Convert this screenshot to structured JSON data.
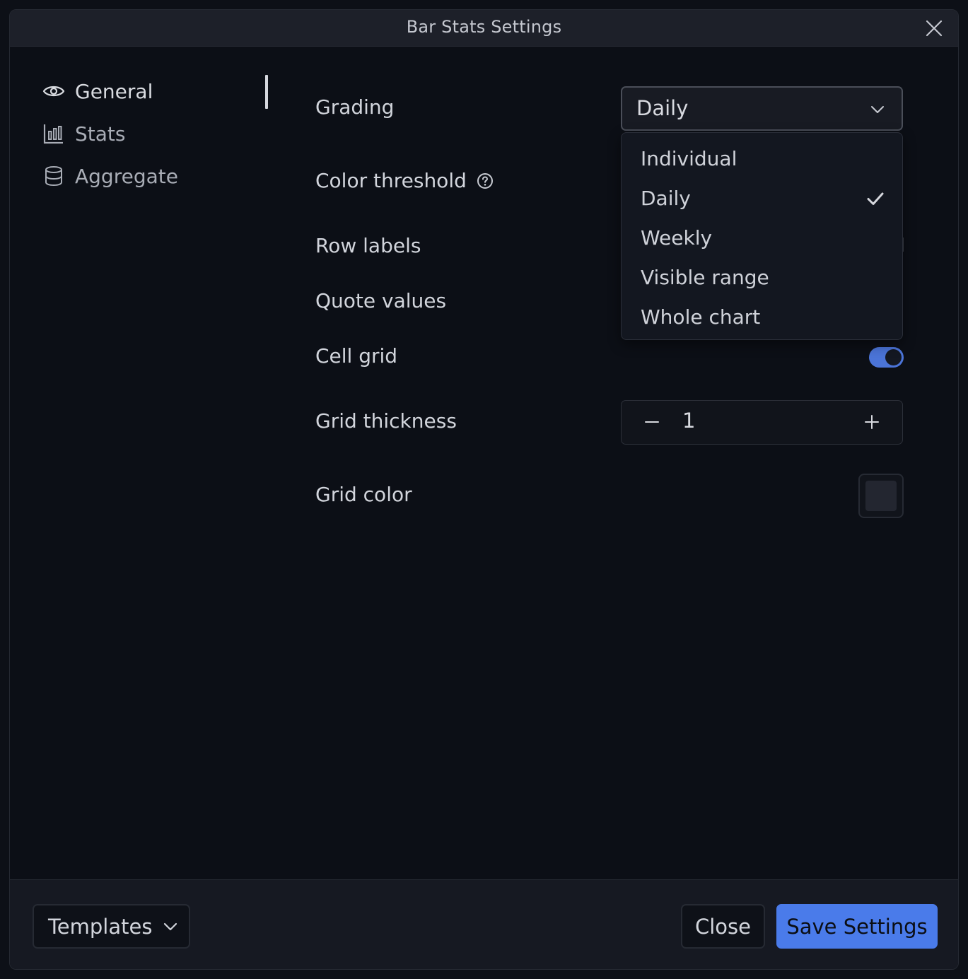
{
  "window": {
    "title": "Bar Stats Settings"
  },
  "sidebar": {
    "items": [
      {
        "label": "General",
        "icon": "eye-icon"
      },
      {
        "label": "Stats",
        "icon": "bar-chart-icon"
      },
      {
        "label": "Aggregate",
        "icon": "database-icon"
      }
    ]
  },
  "settings": {
    "grading": {
      "label": "Grading",
      "value": "Daily"
    },
    "color_threshold": {
      "label": "Color threshold"
    },
    "row_labels": {
      "label": "Row labels"
    },
    "quote_values": {
      "label": "Quote values"
    },
    "cell_grid": {
      "label": "Cell grid",
      "enabled": true
    },
    "grid_thickness": {
      "label": "Grid thickness",
      "value": "1"
    },
    "grid_color": {
      "label": "Grid color",
      "value": "#232630"
    }
  },
  "dropdown": {
    "options": [
      "Individual",
      "Daily",
      "Weekly",
      "Visible range",
      "Whole chart"
    ],
    "selected": "Daily"
  },
  "footer": {
    "templates_label": "Templates",
    "close_label": "Close",
    "save_label": "Save Settings"
  },
  "colors": {
    "accent": "#4a7bea",
    "toggle_on": "#4b74d8",
    "background": "#0c0f16",
    "titlebar": "#1d2029"
  }
}
